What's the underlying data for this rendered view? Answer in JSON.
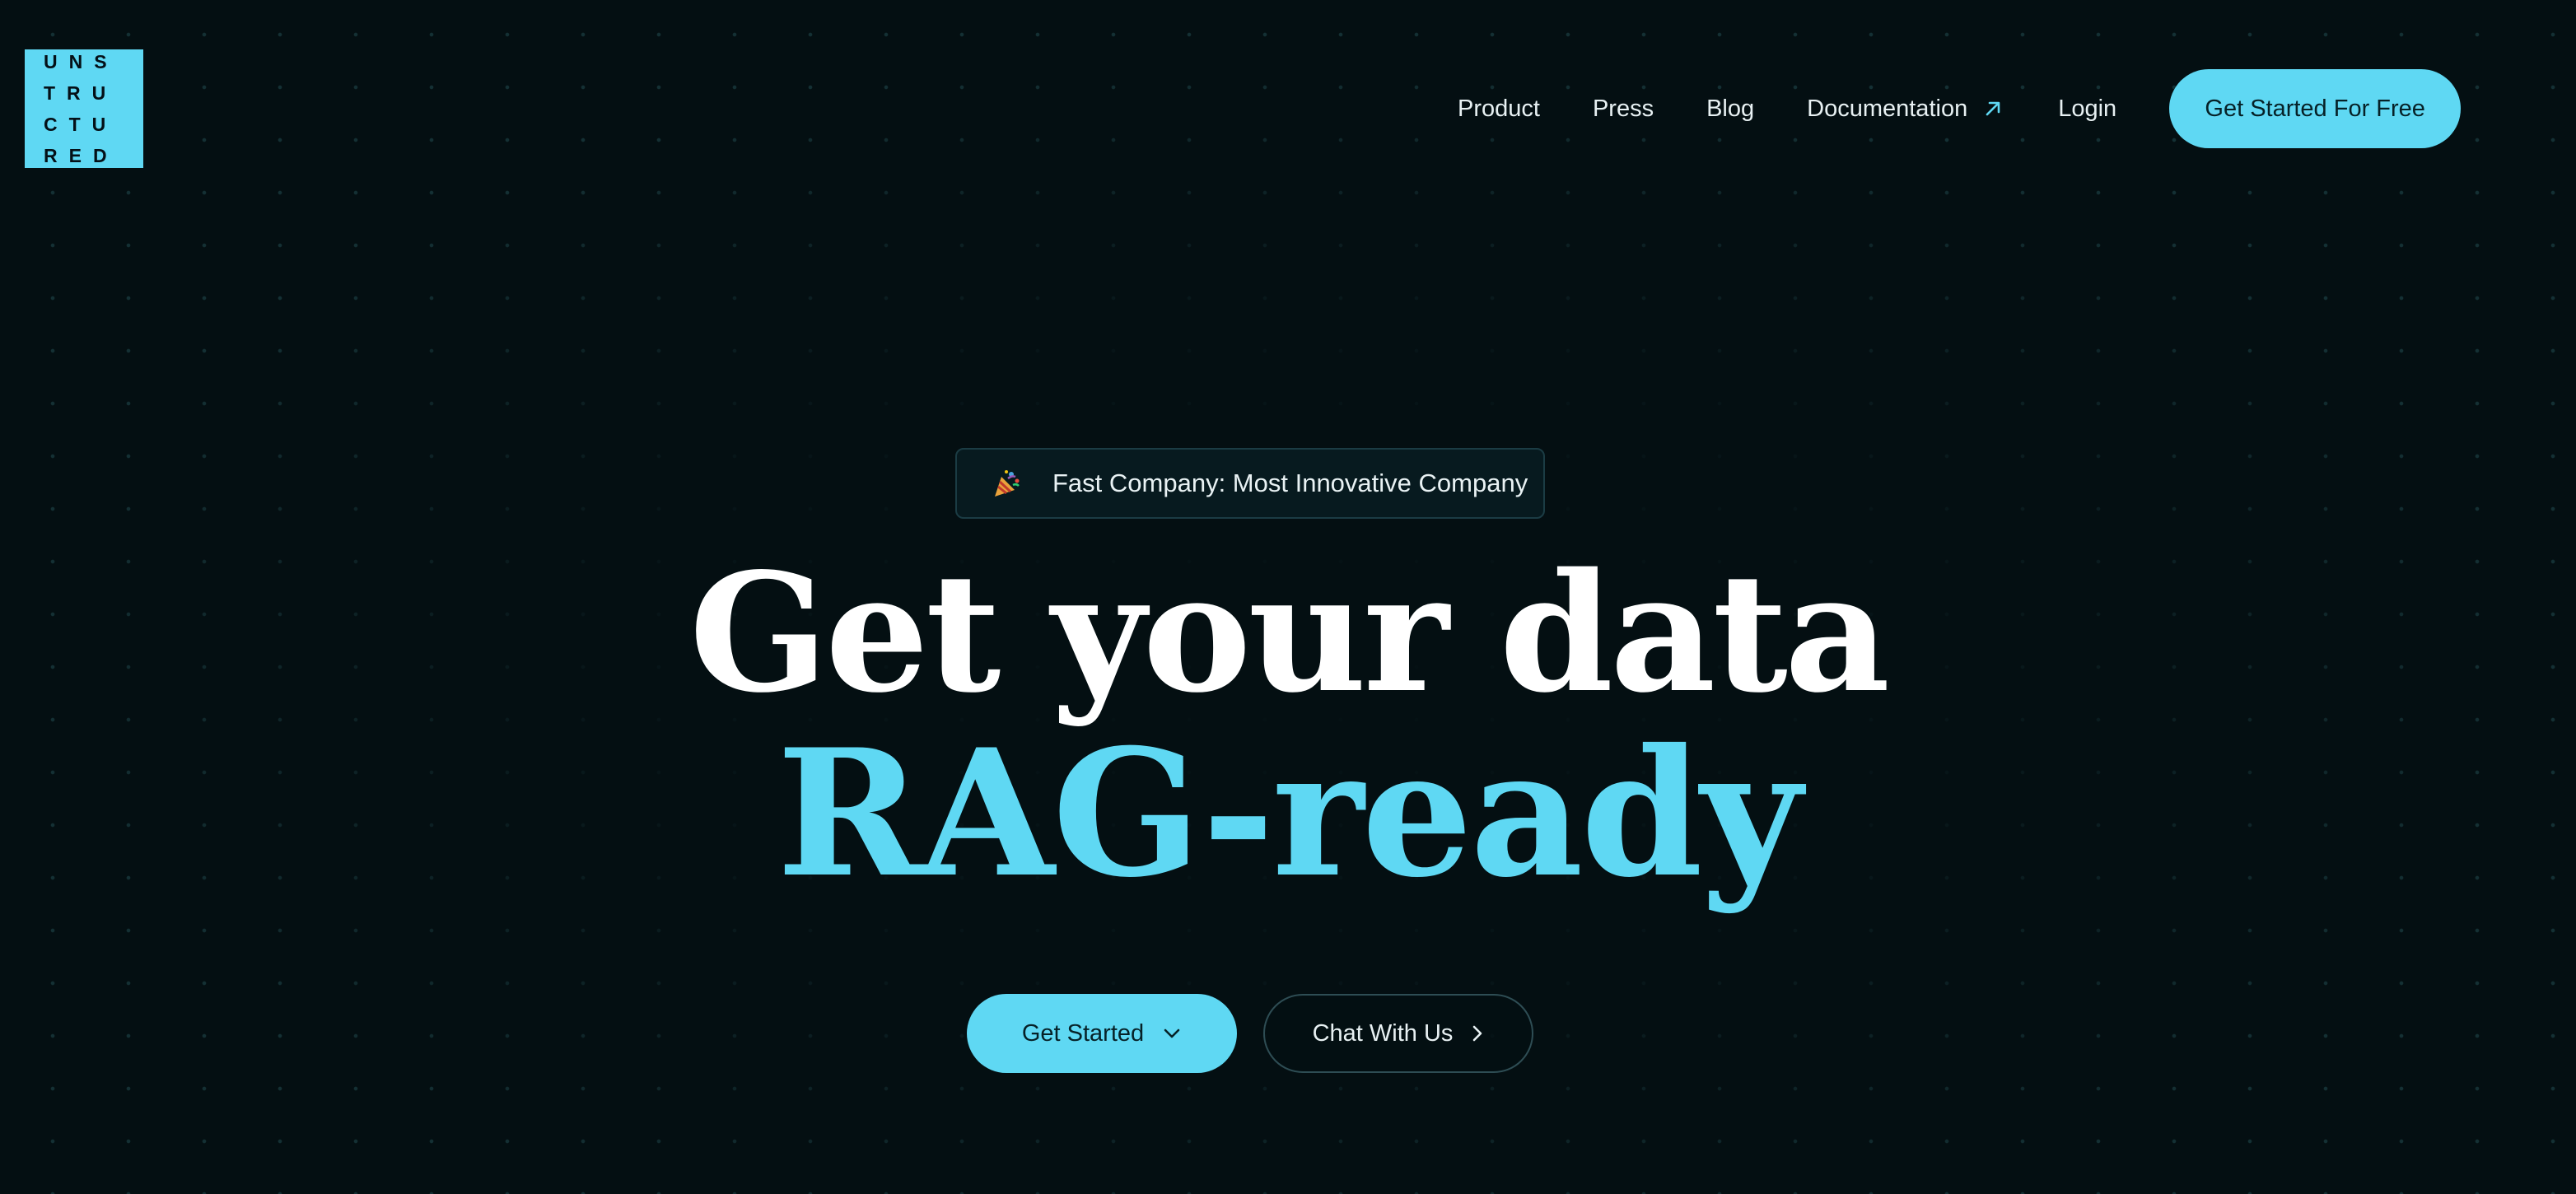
{
  "logo": {
    "text": "UNSTRUCTURED",
    "color": "#5fd8f3"
  },
  "nav": {
    "items": [
      {
        "label": "Product"
      },
      {
        "label": "Press"
      },
      {
        "label": "Blog"
      },
      {
        "label": "Documentation",
        "icon": "external-link-arrow-icon"
      },
      {
        "label": "Login"
      }
    ],
    "cta_label": "Get Started For Free"
  },
  "badge": {
    "icon": "party-popper-icon",
    "text": "Fast Company: Most Innovative Company"
  },
  "hero": {
    "line1": "Get your data",
    "line2": "RAG-ready"
  },
  "actions": {
    "primary_label": "Get Started",
    "primary_icon": "chevron-down-icon",
    "secondary_label": "Chat With Us",
    "secondary_icon": "chevron-right-icon"
  },
  "colors": {
    "background": "#040f12",
    "accent": "#5fd8f3",
    "text": "#ffffff"
  }
}
